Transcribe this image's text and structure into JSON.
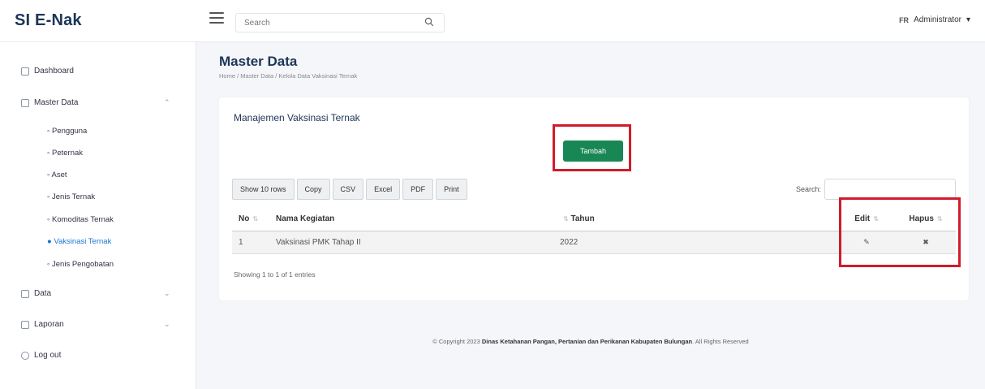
{
  "header": {
    "brand": "SI E-Nak",
    "search_placeholder": "Search",
    "user_initials": "FR",
    "user_name": "Administrator"
  },
  "sidebar": {
    "items": [
      {
        "label": "Dashboard"
      },
      {
        "label": "Master Data"
      },
      {
        "label": "Data"
      },
      {
        "label": "Laporan"
      },
      {
        "label": "Log out"
      }
    ],
    "submenu": [
      {
        "label": "Pengguna"
      },
      {
        "label": "Peternak"
      },
      {
        "label": "Aset"
      },
      {
        "label": "Jenis Ternak"
      },
      {
        "label": "Komoditas Ternak"
      },
      {
        "label": "Vaksinasi Ternak"
      },
      {
        "label": "Jenis Pengobatan"
      }
    ]
  },
  "page": {
    "title": "Master Data",
    "breadcrumb": [
      "Home",
      "Master Data",
      "Kelola Data Vaksinasi Ternak"
    ]
  },
  "card": {
    "title": "Manajemen Vaksinasi Ternak",
    "add_button": "Tambah",
    "export_buttons": [
      "Show 10 rows",
      "Copy",
      "CSV",
      "Excel",
      "PDF",
      "Print"
    ],
    "search_label": "Search:"
  },
  "table": {
    "columns": [
      "No",
      "Nama Kegiatan",
      "Tahun",
      "Edit",
      "Hapus"
    ],
    "rows": [
      {
        "no": "1",
        "nama": "Vaksinasi PMK Tahap II",
        "tahun": "2022"
      }
    ],
    "info": "Showing 1 to 1 of 1 entries"
  },
  "footer": {
    "prefix": "© Copyright 2023",
    "org": "Dinas Ketahanan Pangan, Pertanian dan Perikanan Kabupaten Bulungan",
    "suffix": ". All Rights Reserved"
  },
  "colors": {
    "primary_green": "#198754",
    "highlight_red": "#d01c2a",
    "brand_navy": "#1d3557",
    "active_link": "#1b75d0"
  }
}
